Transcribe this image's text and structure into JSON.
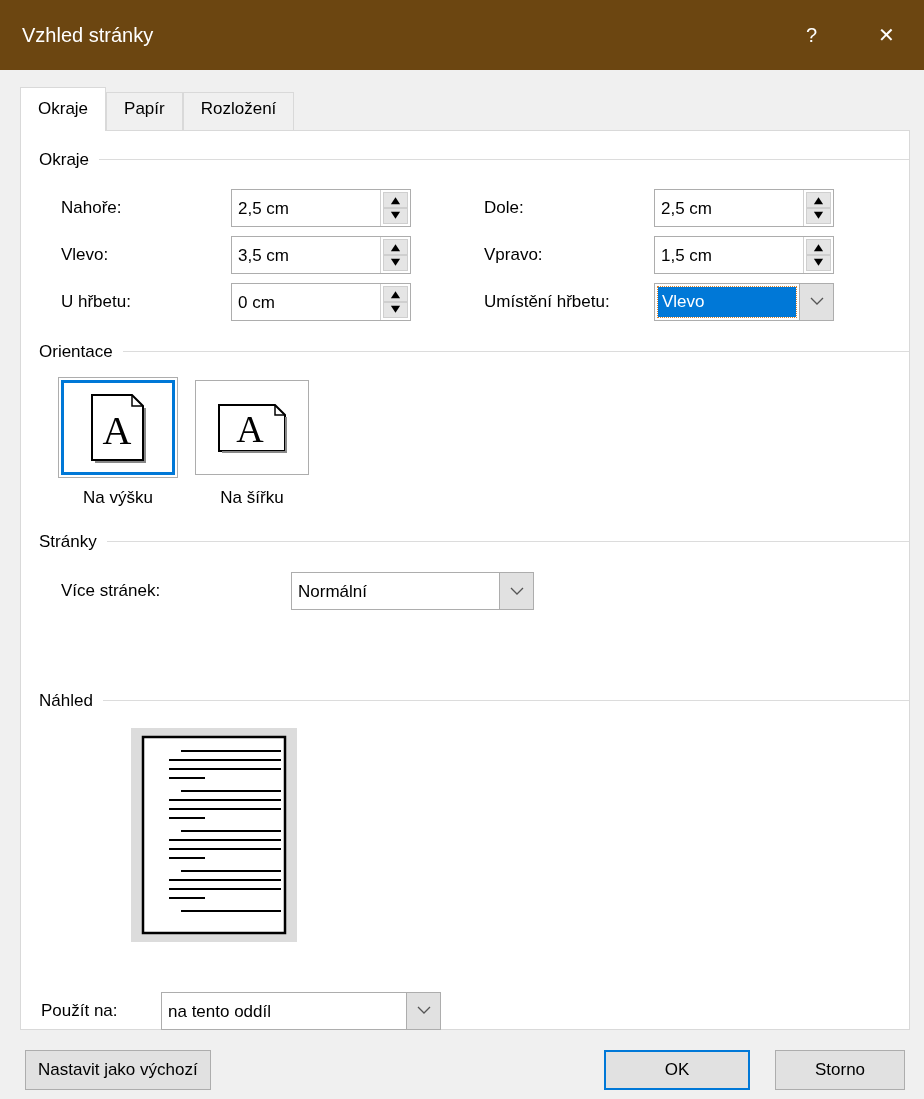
{
  "window": {
    "title": "Vzhled stránky",
    "help": "?",
    "close": "✕"
  },
  "tabs": [
    {
      "label": "Okraje",
      "selected": true
    },
    {
      "label": "Papír",
      "selected": false
    },
    {
      "label": "Rozložení",
      "selected": false
    }
  ],
  "margins": {
    "heading": "Okraje",
    "fields": [
      {
        "label": "Nahoře:",
        "value": "2,5 cm",
        "kind": "spin",
        "highlighted": false
      },
      {
        "label": "Dole:",
        "value": "2,5 cm",
        "kind": "spin",
        "highlighted": false
      },
      {
        "label": "Vlevo:",
        "value": "3,5 cm",
        "kind": "spin",
        "highlighted": false
      },
      {
        "label": "Vpravo:",
        "value": "1,5 cm",
        "kind": "spin",
        "highlighted": false
      },
      {
        "label": "U hřbetu:",
        "value": "0 cm",
        "kind": "spin",
        "highlighted": false
      },
      {
        "label": "Umístění hřbetu:",
        "value": "Vlevo",
        "kind": "select",
        "highlighted": true
      }
    ]
  },
  "orientation": {
    "heading": "Orientace",
    "options": [
      {
        "label": "Na výšku",
        "icon_letter": "A",
        "kind": "portrait",
        "selected": true
      },
      {
        "label": "Na šířku",
        "icon_letter": "A",
        "kind": "landscape",
        "selected": false
      }
    ]
  },
  "pages": {
    "heading": "Stránky",
    "label": "Více stránek:",
    "value": "Normální"
  },
  "preview": {
    "heading": "Náhled"
  },
  "apply_to": {
    "label": "Použít na:",
    "value": "na tento oddíl"
  },
  "buttons": [
    {
      "label": "Nastavit jako výchozí",
      "kind": "left",
      "default": false
    },
    {
      "label": "OK",
      "kind": "right",
      "default": true
    },
    {
      "label": "Storno",
      "kind": "right",
      "default": false
    }
  ]
}
